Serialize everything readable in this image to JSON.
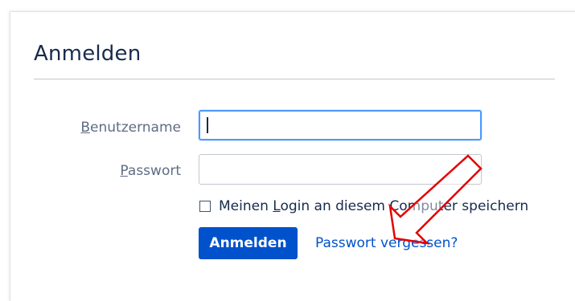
{
  "form": {
    "title": "Anmelden",
    "username_label_accesskey": "B",
    "username_label_rest": "enutzername",
    "username_value": "",
    "password_label_accesskey": "P",
    "password_label_rest": "asswort",
    "password_value": "",
    "remember_before": "Meinen ",
    "remember_accesskey": "L",
    "remember_after": "ogin an diesem Computer speichern",
    "remember_checked": false,
    "submit_label": "Anmelden",
    "forgot_link": "Passwort vergessen?"
  },
  "colors": {
    "primary": "#0052cc",
    "focus_border": "#4c9aff",
    "annotation_arrow": "#e60000"
  }
}
